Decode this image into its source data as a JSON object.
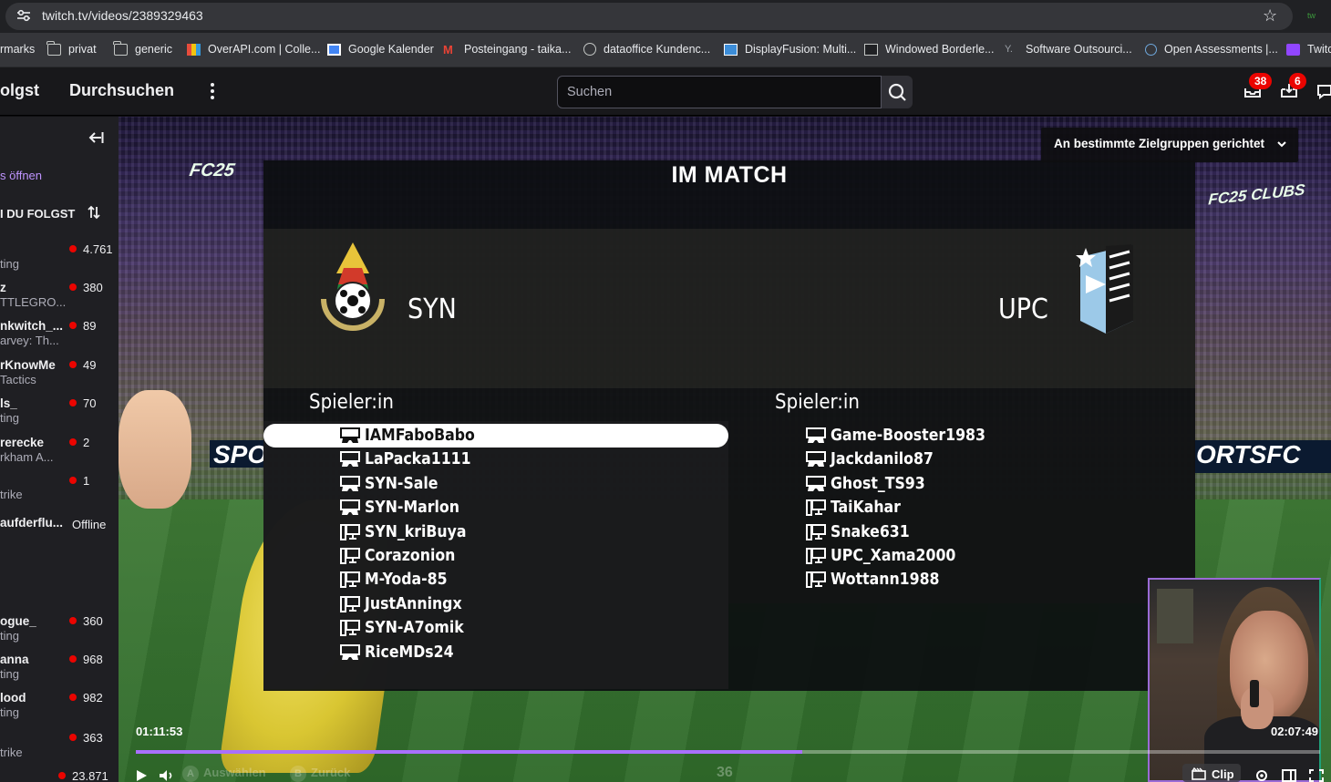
{
  "browser": {
    "url": "twitch.tv/videos/2389329463",
    "bookmarks": [
      {
        "label": "rmarks",
        "icon": "none"
      },
      {
        "label": "privat",
        "icon": "folder-icon"
      },
      {
        "label": "generic",
        "icon": "folder-icon"
      },
      {
        "label": "OverAPI.com | Colle...",
        "icon": "overapi-icon"
      },
      {
        "label": "Google Kalender",
        "icon": "calendar-icon"
      },
      {
        "label": "Posteingang - taika...",
        "icon": "gmail-icon"
      },
      {
        "label": "dataoffice Kundenc...",
        "icon": "globe-icon"
      },
      {
        "label": "DisplayFusion: Multi...",
        "icon": "displayfusion-icon"
      },
      {
        "label": "Windowed Borderle...",
        "icon": "window-icon"
      },
      {
        "label": "Software Outsourci...",
        "icon": "y-icon"
      },
      {
        "label": "Open Assessments |...",
        "icon": "assessment-icon"
      },
      {
        "label": "Twitc",
        "icon": "twitch-icon"
      }
    ]
  },
  "nav": {
    "following": "olgst",
    "browse": "Durchsuchen",
    "search_placeholder": "Suchen",
    "inbox_badge": "38",
    "notif_badge": "6"
  },
  "sidebar": {
    "open_text": "s öffnen",
    "header": "I DU FOLGST",
    "channels": [
      {
        "name": "",
        "game": "ting",
        "viewers": "4.761"
      },
      {
        "name": "z",
        "game": "TTLEGRO...",
        "viewers": "380"
      },
      {
        "name": "nkwitch_...",
        "game": "arvey: Th...",
        "viewers": "89"
      },
      {
        "name": "rKnowMe",
        "game": "Tactics",
        "viewers": "49"
      },
      {
        "name": "ls_",
        "game": "ting",
        "viewers": "70"
      },
      {
        "name": "rerecke",
        "game": "rkham A...",
        "viewers": "2"
      },
      {
        "name": "",
        "game": "trike",
        "viewers": "1"
      },
      {
        "name": "aufderflu...",
        "game": "",
        "viewers": "Offline"
      },
      {
        "name": "ogue_",
        "game": "ting",
        "viewers": "360"
      },
      {
        "name": "anna",
        "game": "ting",
        "viewers": "968"
      },
      {
        "name": "lood",
        "game": "ting",
        "viewers": "982"
      },
      {
        "name": "",
        "game": "trike",
        "viewers": "363"
      },
      {
        "name": "",
        "game": "",
        "viewers": "23.871"
      }
    ]
  },
  "match": {
    "title": "IM MATCH",
    "home_team": "SYN",
    "away_team": "UPC",
    "home_header": "Spieler:in",
    "away_header": "Spieler:in",
    "home_players": [
      {
        "name": "IAMFaboBabo",
        "platform": "console",
        "selected": true
      },
      {
        "name": "LaPacka1111",
        "platform": "console",
        "selected": false
      },
      {
        "name": "SYN-Sale",
        "platform": "console",
        "selected": false
      },
      {
        "name": "SYN-Marlon",
        "platform": "console",
        "selected": false
      },
      {
        "name": "SYN_kriBuya",
        "platform": "pc",
        "selected": false
      },
      {
        "name": "Corazonion",
        "platform": "pc",
        "selected": false
      },
      {
        "name": "M-Yoda-85",
        "platform": "pc",
        "selected": false
      },
      {
        "name": "JustAnningx",
        "platform": "pc",
        "selected": false
      },
      {
        "name": "SYN-A7omik",
        "platform": "pc",
        "selected": false
      },
      {
        "name": "RiceMDs24",
        "platform": "console",
        "selected": false
      }
    ],
    "away_players": [
      {
        "name": "Game-Booster1983",
        "platform": "console"
      },
      {
        "name": "Jackdanilo87",
        "platform": "console"
      },
      {
        "name": "Ghost_TS93",
        "platform": "console"
      },
      {
        "name": "TaiKahar",
        "platform": "pc"
      },
      {
        "name": "Snake631",
        "platform": "pc"
      },
      {
        "name": "UPC_Xama2000",
        "platform": "pc"
      },
      {
        "name": "Wottann1988",
        "platform": "pc"
      }
    ]
  },
  "player": {
    "audience_label": "An bestimmte Zielgruppen gerichtet",
    "time_current": "01:11:53",
    "time_total": "02:07:49",
    "progress_fraction": 0.5625,
    "hint_select": "Auswählen",
    "hint_back": "Zurück",
    "hint_select_key": "A",
    "hint_back_key": "B",
    "score": "36",
    "clip_label": "Clip",
    "ad_left": "SPO",
    "ad_right": "ORTSFC",
    "fc_left": "FC25",
    "fc_right": "FC25 CLUBS"
  },
  "colors": {
    "accent": "#a970ff",
    "live": "#eb0400"
  }
}
